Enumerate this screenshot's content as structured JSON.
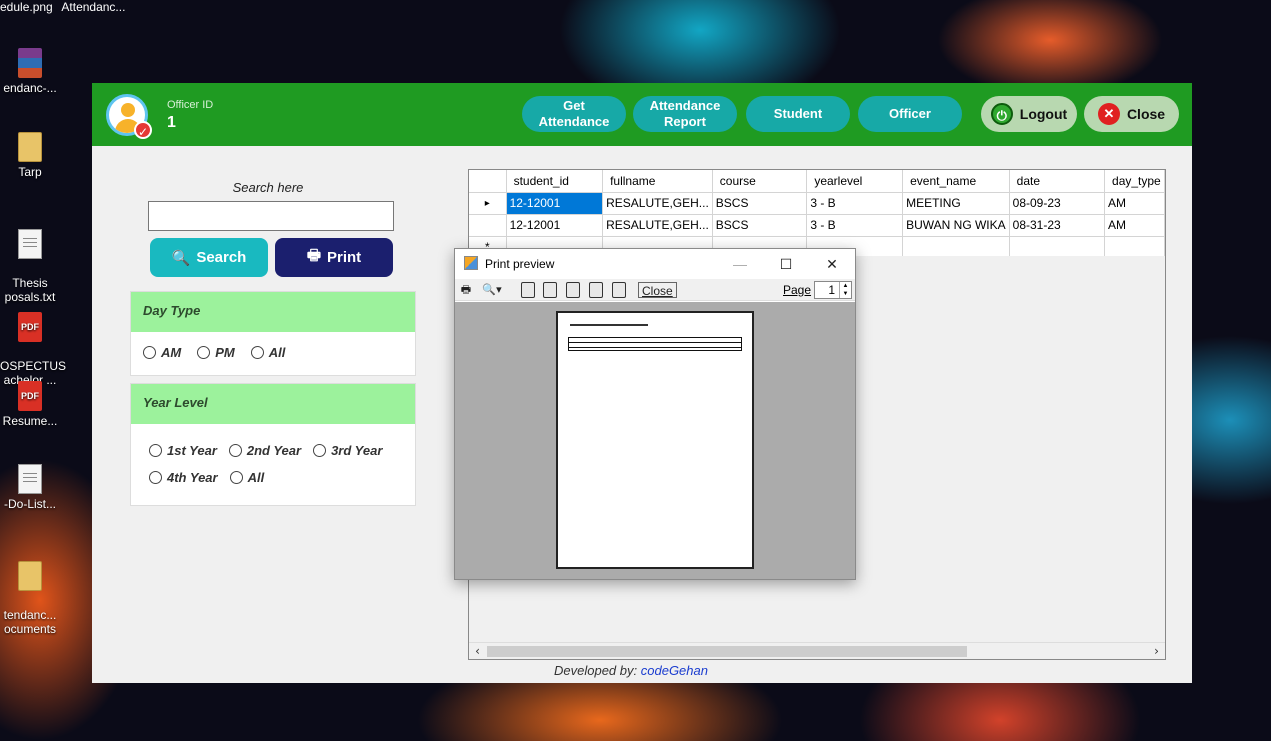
{
  "desktop": {
    "top_files": [
      "edule.png",
      "Attendanc..."
    ],
    "icons": [
      {
        "label": "endanc-...",
        "icon": "rar-icon"
      },
      {
        "label": "Tarp",
        "icon": "folder-icon"
      },
      {
        "label": "Thesis\nposals.txt",
        "icon": "text-file-icon"
      },
      {
        "label": "OSPECTUS\nachelor ...",
        "icon": "pdf-icon"
      },
      {
        "label": "Resume...",
        "icon": "pdf-icon"
      },
      {
        "label": "-Do-List...",
        "icon": "text-file-icon"
      },
      {
        "label": "tendanc...\nocuments",
        "icon": "folder-icon"
      }
    ]
  },
  "header": {
    "officer_label": "Officer ID",
    "officer_value": "1",
    "nav": [
      "Get\nAttendance",
      "Attendance\nReport",
      "Student",
      "Officer"
    ],
    "logout_label": "Logout",
    "close_label": "Close",
    "accent": "#1f9b22"
  },
  "search": {
    "label": "Search here",
    "value": "",
    "search_button": "Search",
    "print_button": "Print"
  },
  "day_type": {
    "title": "Day Type",
    "options": [
      "AM",
      "PM",
      "All"
    ]
  },
  "year_level": {
    "title": "Year Level",
    "options": [
      "1st Year",
      "2nd Year",
      "3rd Year",
      "4th Year",
      "All"
    ]
  },
  "grid": {
    "columns": [
      "student_id",
      "fullname",
      "course",
      "yearlevel",
      "event_name",
      "date",
      "day_type"
    ],
    "rows": [
      [
        "12-12001",
        "RESALUTE,GEH...",
        "BSCS",
        "3 - B",
        "MEETING",
        "08-09-23",
        "AM"
      ],
      [
        "12-12001",
        "RESALUTE,GEH...",
        "BSCS",
        "3 - B",
        "BUWAN NG WIKA",
        "08-31-23",
        "AM"
      ]
    ],
    "new_row_marker": "*",
    "current_row_marker": "▸"
  },
  "footer": {
    "prefix": "Developed by:",
    "brand": "codeGehan"
  },
  "print_preview": {
    "title": "Print preview",
    "close_label": "Close",
    "page_label": "Page",
    "page_value": "1"
  }
}
